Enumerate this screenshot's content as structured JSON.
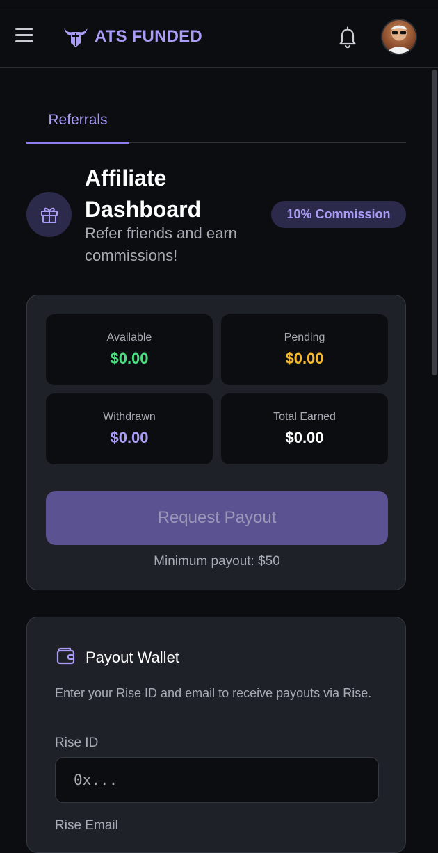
{
  "header": {
    "brand": "ATS FUNDED",
    "icons": {
      "menu": "hamburger-menu-icon",
      "bell": "bell-icon",
      "logo": "bull-shield-logo"
    }
  },
  "tabs": [
    {
      "label": "Referrals",
      "active": true
    }
  ],
  "affiliate": {
    "title": "Affiliate Dashboard",
    "subtitle": "Refer friends and earn commissions!",
    "commission_badge": "10% Commission",
    "icon": "gift-icon"
  },
  "stats": [
    {
      "label": "Available",
      "value": "$0.00",
      "color": "#4ade80"
    },
    {
      "label": "Pending",
      "value": "$0.00",
      "color": "#f5b82e"
    },
    {
      "label": "Withdrawn",
      "value": "$0.00",
      "color": "#a99cf6"
    },
    {
      "label": "Total Earned",
      "value": "$0.00",
      "color": "#ffffff"
    }
  ],
  "payout": {
    "button_label": "Request Payout",
    "minimum_text": "Minimum payout: $50"
  },
  "wallet": {
    "title": "Payout Wallet",
    "icon": "wallet-icon",
    "description": "Enter your Rise ID and email to receive payouts via Rise.",
    "rise_id_label": "Rise ID",
    "rise_id_placeholder": "0x...",
    "rise_email_label": "Rise Email"
  },
  "colors": {
    "accent": "#8b7df0",
    "background": "#0b0d10",
    "card": "#1e2128"
  }
}
